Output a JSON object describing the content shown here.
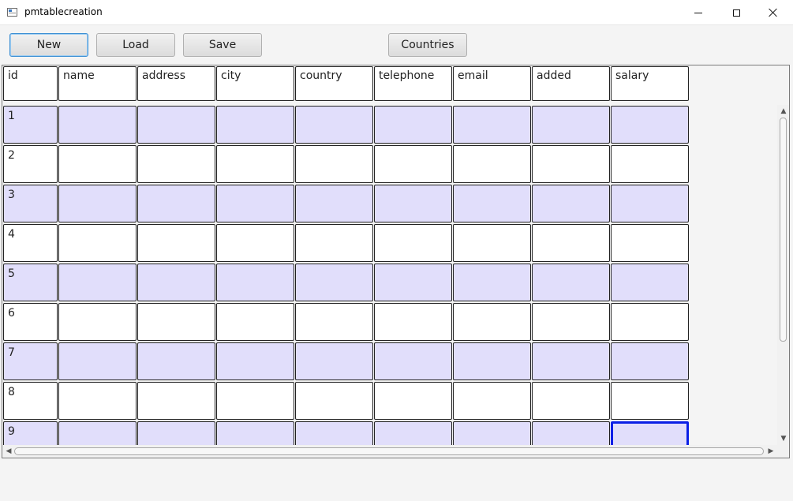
{
  "window": {
    "title": "pmtablecreation",
    "icon": "app-window-icon"
  },
  "toolbar": {
    "new_label": "New",
    "load_label": "Load",
    "save_label": "Save",
    "countries_label": "Countries"
  },
  "table": {
    "columns": [
      "id",
      "name",
      "address",
      "city",
      "country",
      "telephone",
      "email",
      "added",
      "salary"
    ],
    "rows": [
      [
        "1",
        "",
        "",
        "",
        "",
        "",
        "",
        "",
        ""
      ],
      [
        "2",
        "",
        "",
        "",
        "",
        "",
        "",
        "",
        ""
      ],
      [
        "3",
        "",
        "",
        "",
        "",
        "",
        "",
        "",
        ""
      ],
      [
        "4",
        "",
        "",
        "",
        "",
        "",
        "",
        "",
        ""
      ],
      [
        "5",
        "",
        "",
        "",
        "",
        "",
        "",
        "",
        ""
      ],
      [
        "6",
        "",
        "",
        "",
        "",
        "",
        "",
        "",
        ""
      ],
      [
        "7",
        "",
        "",
        "",
        "",
        "",
        "",
        "",
        ""
      ],
      [
        "8",
        "",
        "",
        "",
        "",
        "",
        "",
        "",
        ""
      ],
      [
        "9",
        "",
        "",
        "",
        "",
        "",
        "",
        "",
        ""
      ]
    ],
    "selected_row": 9,
    "selected_column": "salary"
  },
  "colors": {
    "odd_row": "#e1defb",
    "even_row": "#ffffff",
    "selection": "#0a1fe6",
    "focus_button": "#3c8fd4"
  },
  "icons": {
    "minimize": "minimize-icon",
    "maximize": "maximize-icon",
    "close": "close-icon",
    "scroll_up": "chevron-up-icon",
    "scroll_down": "chevron-down-icon",
    "scroll_left": "chevron-left-icon",
    "scroll_right": "chevron-right-icon"
  }
}
